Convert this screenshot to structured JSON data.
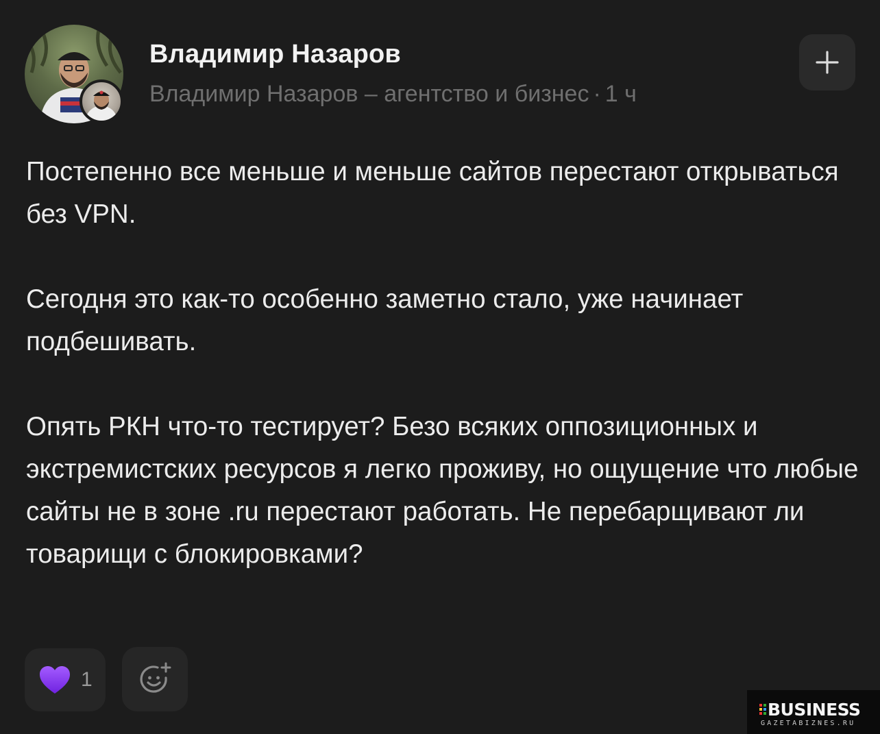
{
  "post": {
    "author_name": "Владимир Назаров",
    "channel": "Владимир Назаров – агентство и бизнес",
    "separator": "·",
    "time": "1 ч",
    "paragraphs": [
      "Постепенно все меньше и меньше сайтов перестают открываться без VPN.",
      "Сегодня это как-то особенно заметно стало, уже начинает подбешивать.",
      "Опять РКН что-то тестирует? Безо всяких оппозиционных и экстремистских ресурсов я легко проживу, но ощущение что любые сайты не в зоне .ru перестают работать. Не перебарщивают ли товарищи с блокировками?"
    ]
  },
  "header": {
    "subscribe_icon": "plus-icon"
  },
  "reactions": {
    "heart_icon": "purple-heart-icon",
    "heart_color": "#8b3dff",
    "count": "1",
    "add_icon": "add-reaction-smiley-icon"
  },
  "watermark": {
    "title": "BUSINESS",
    "subtitle": "GAZETABIZNES.RU"
  },
  "colors": {
    "background": "#1c1c1c",
    "text": "#ececec",
    "muted": "#6f6f6f",
    "button_bg": "#262626"
  }
}
